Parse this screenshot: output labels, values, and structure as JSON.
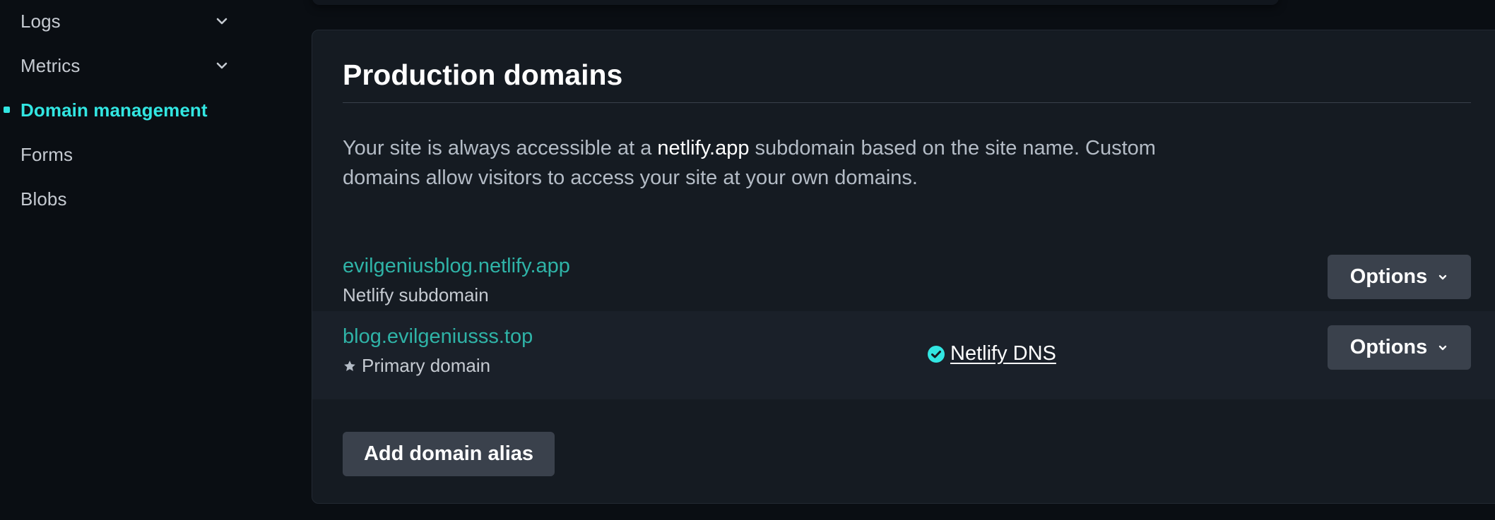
{
  "sidebar": {
    "items": [
      {
        "label": "Logs",
        "expandable": true,
        "active": false
      },
      {
        "label": "Metrics",
        "expandable": true,
        "active": false
      },
      {
        "label": "Domain management",
        "expandable": false,
        "active": true
      },
      {
        "label": "Forms",
        "expandable": false,
        "active": false
      },
      {
        "label": "Blobs",
        "expandable": false,
        "active": false
      }
    ]
  },
  "section": {
    "title": "Production domains",
    "description_before": "Your site is always accessible at a ",
    "description_highlight": "netlify.app",
    "description_after": " subdomain based on the site name. Custom domains allow visitors to access your site at your own domains.",
    "domains": [
      {
        "name": "evilgeniusblog.netlify.app",
        "subtitle": "Netlify subdomain",
        "options_label": "Options"
      },
      {
        "name": "blog.evilgeniusss.top",
        "subtitle": "Primary domain",
        "dns_label": "Netlify DNS",
        "options_label": "Options"
      }
    ],
    "add_alias_label": "Add domain alias"
  },
  "colors": {
    "accent": "#32e6e2",
    "link": "#2fb3a7",
    "background": "#0a0e13",
    "card": "#151b22",
    "button": "#3a414c"
  },
  "icons": {
    "chevron": "chevron-down-icon",
    "star": "star-icon",
    "check": "check-circle-icon",
    "active_marker": "active-dot-icon"
  }
}
